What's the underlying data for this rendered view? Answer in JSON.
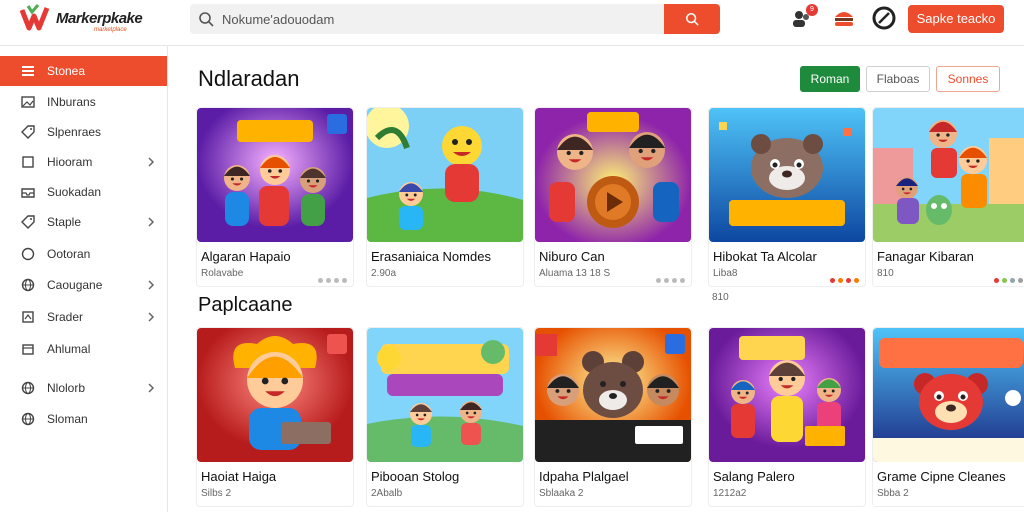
{
  "header": {
    "logo_text": "Markerpkake",
    "logo_sub": "marketplace",
    "search": {
      "value": "Nokume'adouodam"
    },
    "cta_label": "Sapke teacko",
    "notification_count": "9"
  },
  "sidebar": {
    "items": [
      {
        "label": "Stonea",
        "icon": "list-icon",
        "active": true,
        "chevron": false
      },
      {
        "label": "INburans",
        "icon": "image-icon",
        "chevron": false
      },
      {
        "label": "Slpenraes",
        "icon": "tag-icon",
        "chevron": false
      },
      {
        "label": "Hiooram",
        "icon": "square-icon",
        "chevron": true
      },
      {
        "label": "Suokadan",
        "icon": "tray-icon",
        "chevron": false
      },
      {
        "label": "Staple",
        "icon": "tag-icon",
        "chevron": true
      },
      {
        "label": "Ootoran",
        "icon": "circle-icon",
        "chevron": false
      },
      {
        "label": "Caougane",
        "icon": "globe-icon",
        "chevron": true
      },
      {
        "label": "Srader",
        "icon": "crop-icon",
        "chevron": true
      },
      {
        "label": "Ahlumal",
        "icon": "box-icon",
        "chevron": false
      },
      {
        "label": "Nlolorb",
        "icon": "globe-icon",
        "chevron": true
      },
      {
        "label": "Sloman",
        "icon": "globe-icon",
        "chevron": false
      }
    ]
  },
  "section1": {
    "title": "Ndlaradan",
    "chips": [
      {
        "label": "Roman",
        "style": "green"
      },
      {
        "label": "Flaboas",
        "style": "outline-gray"
      },
      {
        "label": "Sonnes",
        "style": "outline-orange"
      }
    ],
    "cards": [
      {
        "title": "Algaran Hapaio",
        "sub": "Rolavabe",
        "dots": [
          "#bbb",
          "#bbb",
          "#bbb",
          "#bbb"
        ],
        "art": "purple"
      },
      {
        "title": "Erasaniaica Nomdes",
        "sub": "2.90a",
        "dots": [],
        "art": "green"
      },
      {
        "title": "Niburo Can",
        "sub": "Aluama 13 18 S",
        "dots": [
          "#bbb",
          "#bbb",
          "#bbb",
          "#bbb"
        ],
        "art": "gold"
      },
      {
        "title": "Hibokat Ta Alcolar",
        "sub": "Liba8",
        "dots": [
          "#e53935",
          "#f57c00",
          "#e53935",
          "#f57c00"
        ],
        "art": "blue"
      },
      {
        "title": "Fanagar Kibaran",
        "sub": "810",
        "dots": [
          "#e53935",
          "#8bc34a",
          "#90a4ae",
          "#9e9e9e"
        ],
        "art": "street"
      }
    ],
    "card_subs_extra": [
      "",
      "",
      "",
      "810",
      ""
    ]
  },
  "section2": {
    "title": "Paplcaane",
    "cards": [
      {
        "title": "Haoiat Haiga",
        "sub": "Silbs 2",
        "art": "redkid"
      },
      {
        "title": "Pibooan Stolog",
        "sub": "2Abalb",
        "art": "kuka"
      },
      {
        "title": "Idpaha Plalgael",
        "sub": "Sblaaka 2",
        "art": "bear"
      },
      {
        "title": "Salang Palero",
        "sub": "1212a2",
        "art": "violet"
      },
      {
        "title": "Grame Cipne Cleanes",
        "sub": "Sbba 2",
        "art": "harop"
      }
    ]
  },
  "colors": {
    "accent": "#ee4d2d",
    "green": "#1e8a3c"
  }
}
